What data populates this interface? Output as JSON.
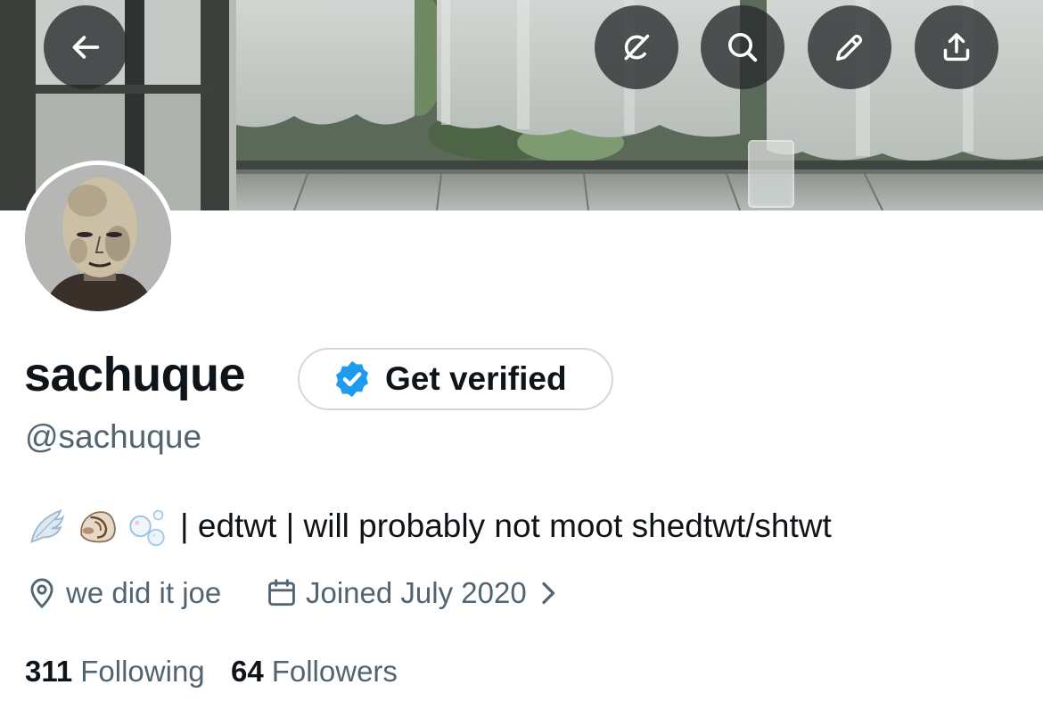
{
  "profile": {
    "display_name": "sachuque",
    "handle": "@sachuque",
    "bio_text": "| edtwt | will probably not moot shedtwt/shtwt",
    "bio_emojis": [
      "wing-emoji",
      "spiral-shell-emoji",
      "bubbles-emoji"
    ],
    "location": "we did it joe",
    "joined": "Joined July 2020",
    "following_count": "311",
    "following_label": "Following",
    "followers_count": "64",
    "followers_label": "Followers"
  },
  "verify_button": {
    "label": "Get verified",
    "icon": "verified-badge-icon"
  },
  "header_buttons": [
    "back-arrow-icon",
    "grok-icon",
    "search-icon",
    "edit-pencil-icon",
    "share-icon"
  ],
  "colors": {
    "text_primary": "#0f1419",
    "text_secondary": "#536471",
    "verified_blue": "#1d9bf0",
    "border": "#cfd9de",
    "header_button_bg": "#262a2c"
  }
}
